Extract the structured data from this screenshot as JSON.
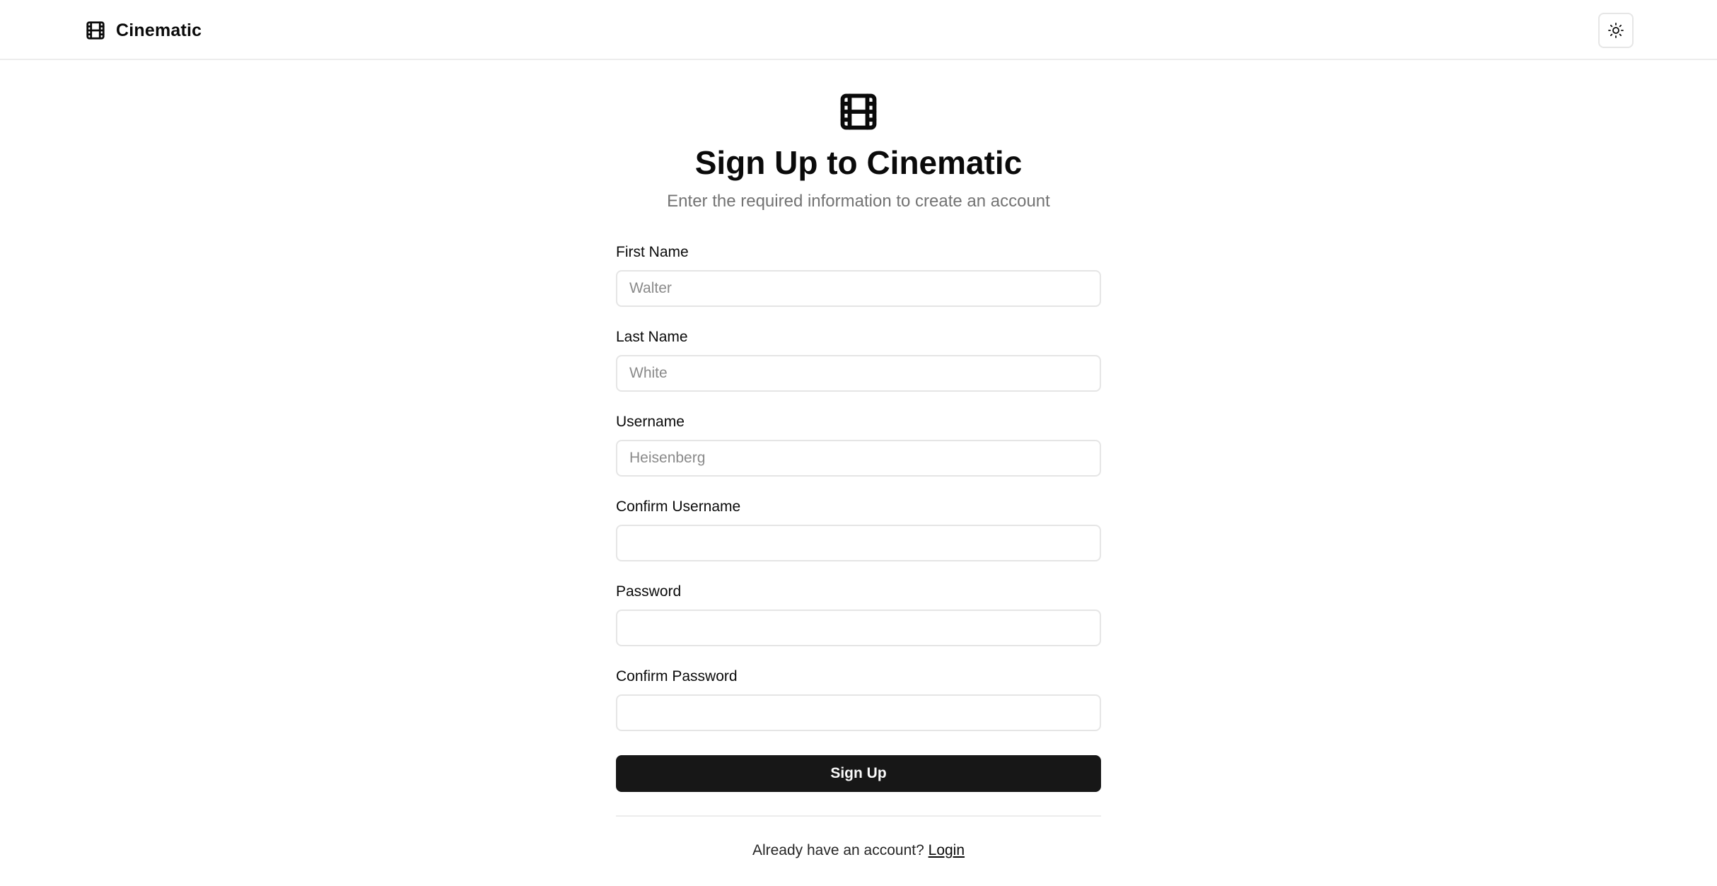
{
  "app": {
    "name": "Cinematic",
    "brand_icon": "film-icon",
    "theme_toggle_icon": "sun-icon"
  },
  "hero": {
    "icon": "film-icon",
    "title": "Sign Up to Cinematic",
    "subtitle": "Enter the required information to create an account"
  },
  "form": {
    "fields": [
      {
        "label": "First Name",
        "value": "",
        "placeholder": "Walter",
        "type": "text"
      },
      {
        "label": "Last Name",
        "value": "",
        "placeholder": "White",
        "type": "text"
      },
      {
        "label": "Username",
        "value": "",
        "placeholder": "Heisenberg",
        "type": "text"
      },
      {
        "label": "Confirm Username",
        "value": "",
        "placeholder": "",
        "type": "text"
      },
      {
        "label": "Password",
        "value": "",
        "placeholder": "",
        "type": "password"
      },
      {
        "label": "Confirm Password",
        "value": "",
        "placeholder": "",
        "type": "password"
      }
    ],
    "submit_label": "Sign Up"
  },
  "footer": {
    "prompt_text": "Already have an account?",
    "login_label": "Login"
  },
  "colors": {
    "primary_button": "#171717",
    "muted_text": "#737373",
    "border": "#e5e5e5"
  }
}
